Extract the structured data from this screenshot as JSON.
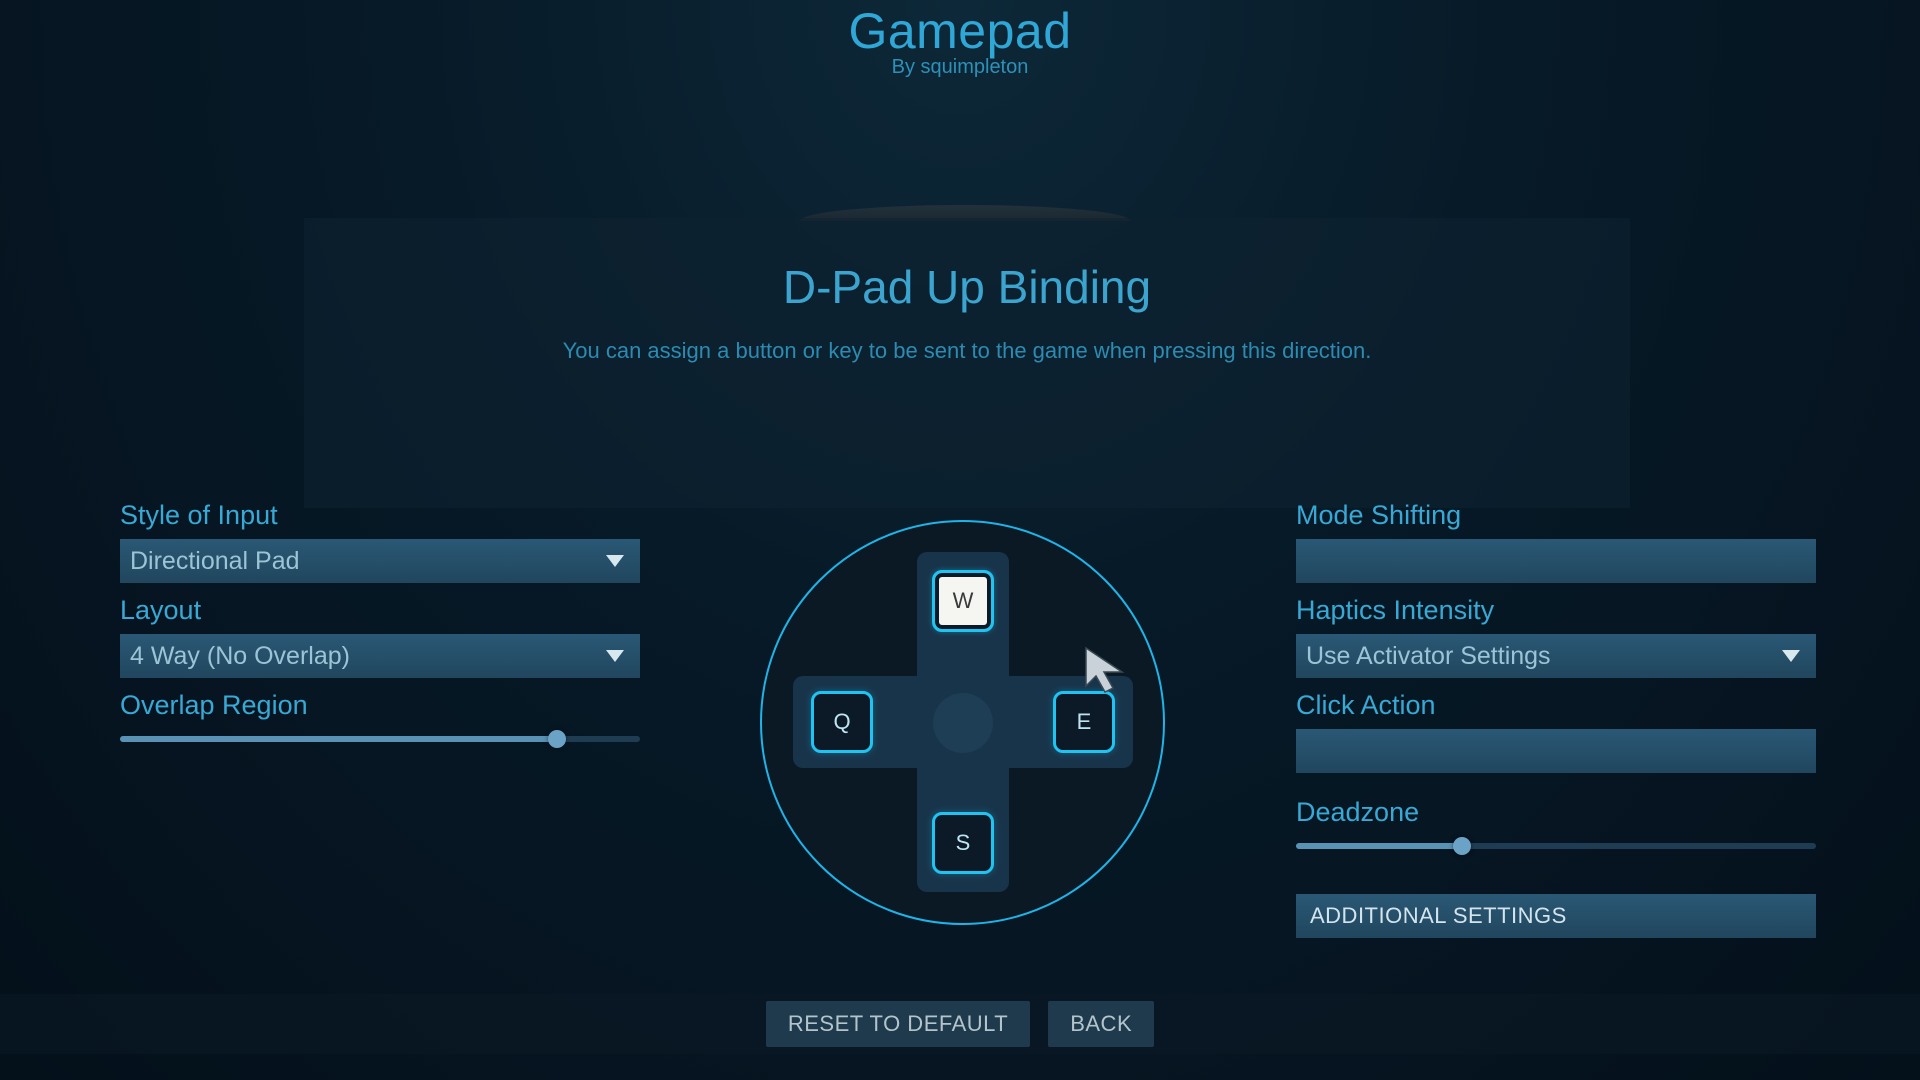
{
  "header": {
    "title": "Gamepad",
    "subtitle": "By squimpleton"
  },
  "panel": {
    "title": "D-Pad Up Binding",
    "description": "You can assign a button or key to be sent to the game when pressing this direction."
  },
  "left": {
    "style_label": "Style of Input",
    "style_value": "Directional Pad",
    "layout_label": "Layout",
    "layout_value": "4 Way (No Overlap)",
    "overlap_label": "Overlap Region",
    "overlap_percent": 84
  },
  "right": {
    "mode_label": "Mode Shifting",
    "haptics_label": "Haptics Intensity",
    "haptics_value": "Use Activator Settings",
    "click_label": "Click Action",
    "deadzone_label": "Deadzone",
    "deadzone_percent": 32,
    "additional_label": "ADDITIONAL SETTINGS"
  },
  "dpad": {
    "up": "W",
    "left": "Q",
    "right": "E",
    "down": "S",
    "selected": "up"
  },
  "footer": {
    "reset": "RESET TO DEFAULT",
    "back": "BACK"
  }
}
